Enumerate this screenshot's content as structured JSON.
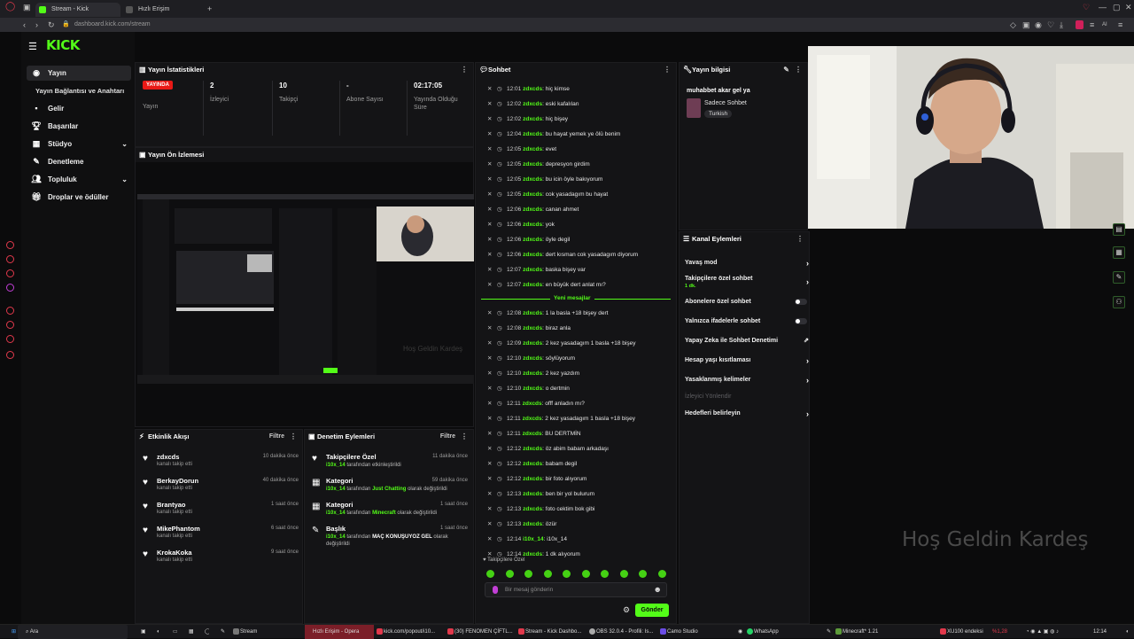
{
  "browser": {
    "tabs": [
      {
        "label": "Stream - Kick Dashboard",
        "active": true
      },
      {
        "label": "Hızlı Erişim",
        "active": false
      }
    ],
    "new_tab": "+",
    "url": "dashboard.kick.com/stream"
  },
  "brand": {
    "logo": "KICK",
    "accent": "#53fc18",
    "live_color": "#e91916"
  },
  "sidebar": {
    "items": [
      {
        "label": "Yayın",
        "icon": "broadcast-icon",
        "selected": true
      },
      {
        "label": "Yayın Bağlantısı ve Anahtarı",
        "sub": true
      },
      {
        "label": "Gelir",
        "icon": "wallet-icon"
      },
      {
        "label": "Başarılar",
        "icon": "trophy-icon"
      },
      {
        "label": "Stüdyo",
        "icon": "studio-icon",
        "expandable": true
      },
      {
        "label": "Denetleme",
        "icon": "hammer-icon"
      },
      {
        "label": "Topluluk",
        "icon": "users-icon",
        "expandable": true
      },
      {
        "label": "Droplar ve ödüller",
        "icon": "gift-icon"
      }
    ]
  },
  "stats": {
    "title": "Yayın İstatistikleri",
    "live_badge": "YAYINDA",
    "columns": [
      {
        "value": "",
        "label": "Yayın"
      },
      {
        "value": "2",
        "label": "İzleyici"
      },
      {
        "value": "10",
        "label": "Takipçi"
      },
      {
        "value": "-",
        "label": "Abone Sayısı"
      },
      {
        "value": "02:17:05",
        "label": "Yayında Olduğu Süre"
      }
    ]
  },
  "preview": {
    "title": "Yayın Ön İzlemesi",
    "overlay_text": "Hoş Geldin Kardeş"
  },
  "activity": {
    "title": "Etkinlik Akışı",
    "filter": "Filtre",
    "items": [
      {
        "name": "zdxcds",
        "sub": "kanalı takip etti",
        "time": "10 dakika önce"
      },
      {
        "name": "BerkayDorun",
        "sub": "kanalı takip etti",
        "time": "40 dakika önce"
      },
      {
        "name": "Brantyao",
        "sub": "kanalı takip etti",
        "time": "1 saat önce"
      },
      {
        "name": "MikePhantom",
        "sub": "kanalı takip etti",
        "time": "6 saat önce"
      },
      {
        "name": "KrokaKoka",
        "sub": "kanalı takip etti",
        "time": "9 saat önce"
      }
    ]
  },
  "moderation": {
    "title": "Denetim Eylemleri",
    "filter": "Filtre",
    "items": [
      {
        "name": "Takipçilere Özel",
        "actor": "i10x_14",
        "text": " tarafından etkinleştirildi",
        "highlight": "",
        "tail": "",
        "time": "11 dakika önce"
      },
      {
        "name": "Kategori",
        "actor": "i10x_14",
        "text": " tarafından ",
        "highlight": "Just Chatting",
        "tail": " olarak değiştirildi",
        "time": "59 dakika önce"
      },
      {
        "name": "Kategori",
        "actor": "i10x_14",
        "text": " tarafından ",
        "highlight": "Minecraft",
        "tail": " olarak değiştirildi",
        "time": "1 saat önce"
      },
      {
        "name": "Başlık",
        "actor": "i10x_14",
        "text": " tarafından ",
        "highlight": "MAÇ KONUŞUYOZ GEL",
        "tail": " olarak değiştirildi",
        "time": "1 saat önce"
      }
    ]
  },
  "chat": {
    "title": "Sohbet",
    "user": "zdxcds",
    "messages": [
      {
        "t": "12:01",
        "m": "hiç kimse"
      },
      {
        "t": "12:02",
        "m": "eski kafalıları"
      },
      {
        "t": "12:02",
        "m": "hiç bişey"
      },
      {
        "t": "12:04",
        "m": "bu hayat yemek ye ölü benim"
      },
      {
        "t": "12:05",
        "m": "evet"
      },
      {
        "t": "12:05",
        "m": "depresyon girdim"
      },
      {
        "t": "12:05",
        "m": "bu icin öyle bakıyorum"
      },
      {
        "t": "12:05",
        "m": "cok yasadagım bu hayat"
      },
      {
        "t": "12:06",
        "m": "canan ahmet"
      },
      {
        "t": "12:06",
        "m": "yok"
      },
      {
        "t": "12:06",
        "m": "öyle degil"
      },
      {
        "t": "12:06",
        "m": "dert kısman cok yasadagım diyorum"
      },
      {
        "t": "12:07",
        "m": "baska bişey var"
      },
      {
        "t": "12:07",
        "m": "en büyük dert anlat mı?"
      }
    ],
    "new_label": "Yeni mesajlar",
    "new_messages": [
      {
        "t": "12:08",
        "m": "1 la basla +18 bişey dert"
      },
      {
        "t": "12:08",
        "m": "biraz anla"
      },
      {
        "t": "12:09",
        "m": "2 kez yasadagım 1 basla +18 bişey"
      },
      {
        "t": "12:10",
        "m": "söylüyorum"
      },
      {
        "t": "12:10",
        "m": "2 kez yazdım"
      },
      {
        "t": "12:10",
        "m": "o dertmin"
      },
      {
        "t": "12:11",
        "m": "offf anladın mı?"
      },
      {
        "t": "12:11",
        "m": "2 kez yasadagım 1 basla +18 bişey"
      },
      {
        "t": "12:11",
        "m": "BU DERTMİN"
      },
      {
        "t": "12:12",
        "m": "öz abim babam arkadaşı"
      },
      {
        "t": "12:12",
        "m": "babam degil"
      },
      {
        "t": "12:12",
        "m": "bir foto alıyorum"
      },
      {
        "t": "12:13",
        "m": "ben bir yol bulurum"
      },
      {
        "t": "12:13",
        "m": "foto cektim bok gibi"
      },
      {
        "t": "12:13",
        "m": "özür"
      }
    ],
    "mod_messages": [
      {
        "t": "12:14",
        "u": "i10x_14",
        "m": "i10x_14"
      },
      {
        "t": "12:14",
        "u": "zdxcds",
        "m": "1 dk alıyorum"
      }
    ],
    "follower_mode": "Takipçilere Özel",
    "input_placeholder": "Bir mesaj gönderin",
    "send": "Gönder"
  },
  "stream_info": {
    "title": "Yayın bilgisi",
    "stream_title": "muhabbet akar gel ya",
    "category": "Sadece Sohbet",
    "tag": "Turkish"
  },
  "channel_actions": {
    "title": "Kanal Eylemleri",
    "items": [
      {
        "label": "Yavaş mod",
        "kind": "chevron",
        "note": ""
      },
      {
        "label": "Takipçilere özel sohbet",
        "kind": "chevron",
        "note": "1 dk."
      },
      {
        "label": "Abonelere özel sohbet",
        "kind": "toggle",
        "note": ""
      },
      {
        "label": "Yalnızca ifadelerle sohbet",
        "kind": "toggle",
        "note": ""
      },
      {
        "label": "Yapay Zeka ile Sohbet Denetimi",
        "kind": "external",
        "note": ""
      },
      {
        "label": "Hesap yaşı kısıtlaması",
        "kind": "chevron",
        "note": ""
      },
      {
        "label": "Yasaklanmış kelimeler",
        "kind": "chevron",
        "note": ""
      },
      {
        "label": "İzleyici Yönlendir",
        "kind": "disabled",
        "note": ""
      },
      {
        "label": "Hedefleri belirleyin",
        "kind": "chevron",
        "note": ""
      }
    ]
  },
  "taskbar": {
    "search": "Ara",
    "items": [
      "Stream",
      "Hızlı Erişim - Opera",
      "kick.com/popout/i10...",
      "(30) FENOMEN ÇİFTL...",
      "Stream - Kick Dashbo...",
      "OBS 32.0.4 - Profili: Is...",
      "Camo Studio",
      "WhatsApp",
      "Minecraft* 1.21"
    ],
    "stock": "XU100 endeksi",
    "stock_change": "%1,28",
    "time": "12:14"
  }
}
